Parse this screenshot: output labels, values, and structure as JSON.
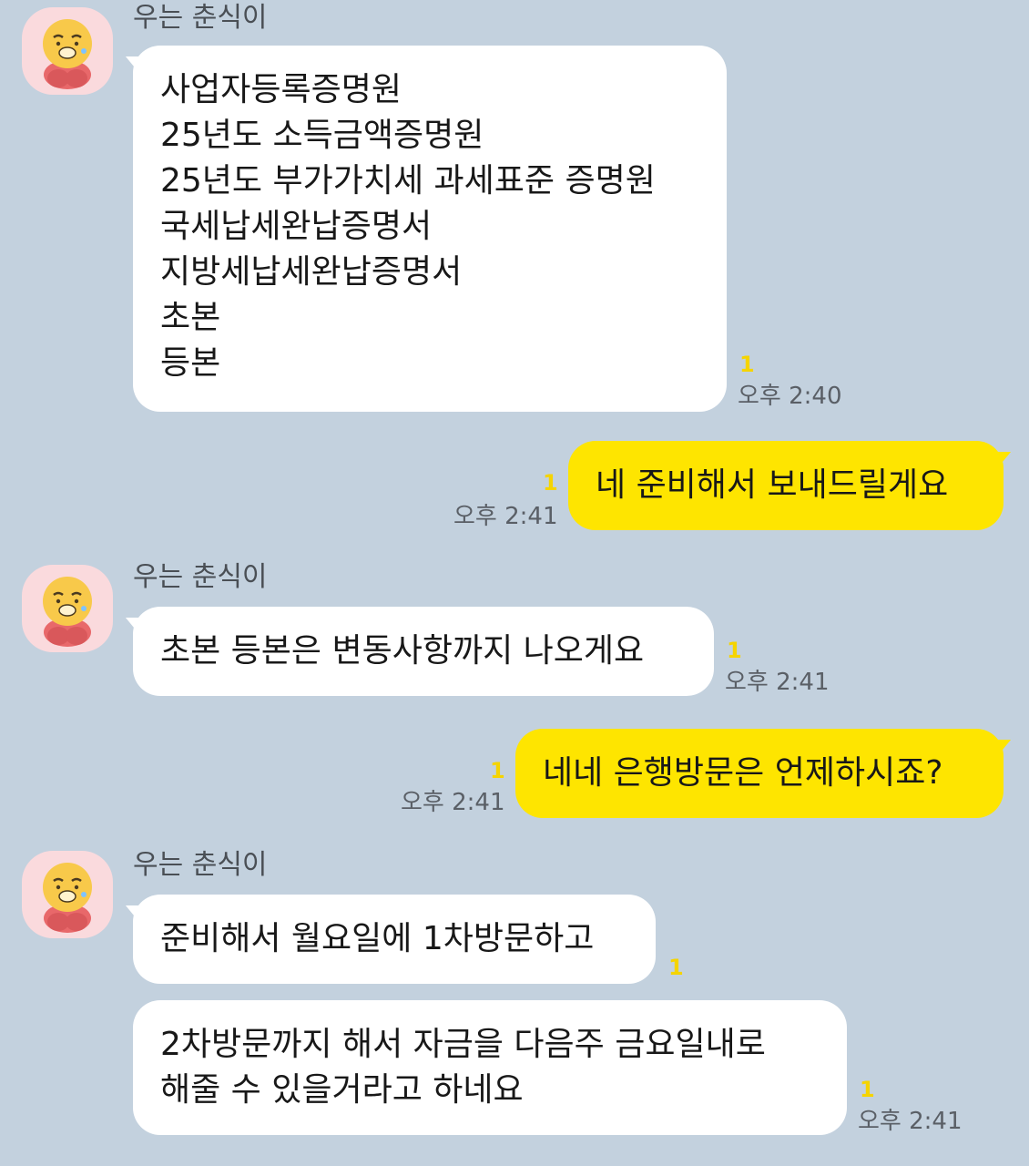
{
  "sender_name": "우는 춘식이",
  "messages": [
    {
      "from": "other",
      "lines": [
        "사업자등록증명원",
        "25년도 소득금액증명원",
        "25년도 부가가치세 과세표준 증명원",
        "국세납세완납증명서",
        "지방세납세완납증명서",
        "초본",
        "등본"
      ],
      "unread": "1",
      "time": "오후 2:40"
    },
    {
      "from": "me",
      "text": "네 준비해서 보내드릴게요",
      "unread": "1",
      "time": "오후 2:41"
    },
    {
      "from": "other",
      "text": "초본 등본은 변동사항까지 나오게요",
      "unread": "1",
      "time": "오후 2:41"
    },
    {
      "from": "me",
      "text": "네네 은행방문은 언제하시죠?",
      "unread": "1",
      "time": "오후 2:41"
    },
    {
      "from": "other",
      "text": "준비해서 월요일에 1차방문하고",
      "unread": "1"
    },
    {
      "from": "other",
      "lines": [
        "2차방문까지 해서 자금을 다음주 금요일내로",
        "해줄 수 있을거라고 하네요"
      ],
      "unread": "1",
      "time": "오후 2:41"
    }
  ],
  "colors": {
    "background": "#c3d1de",
    "incoming_bubble": "#ffffff",
    "outgoing_bubble": "#fee500",
    "unread_count": "#f5d400"
  },
  "icons": {
    "avatar": "choonsik-crying-avatar-icon"
  }
}
